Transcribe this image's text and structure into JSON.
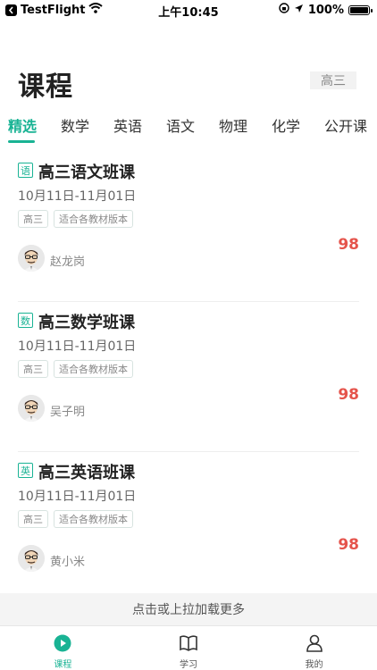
{
  "status_bar": {
    "app": "TestFlight",
    "time": "上午10:45",
    "battery": "100%"
  },
  "header": {
    "title": "课程",
    "grade": "高三"
  },
  "tabs": [
    {
      "label": "精选",
      "active": true
    },
    {
      "label": "数学",
      "active": false
    },
    {
      "label": "英语",
      "active": false
    },
    {
      "label": "语文",
      "active": false
    },
    {
      "label": "物理",
      "active": false
    },
    {
      "label": "化学",
      "active": false
    },
    {
      "label": "公开课",
      "active": false
    }
  ],
  "courses": [
    {
      "badge": "语",
      "title": "高三语文班课",
      "dates": "10月11日-11月01日",
      "tags": [
        "高三",
        "适合各教材版本"
      ],
      "teacher": "赵龙岗",
      "price": "98"
    },
    {
      "badge": "数",
      "title": "高三数学班课",
      "dates": "10月11日-11月01日",
      "tags": [
        "高三",
        "适合各教材版本"
      ],
      "teacher": "吴子明",
      "price": "98"
    },
    {
      "badge": "英",
      "title": "高三英语班课",
      "dates": "10月11日-11月01日",
      "tags": [
        "高三",
        "适合各教材版本"
      ],
      "teacher": "黄小米",
      "price": "98"
    }
  ],
  "load_more": "点击或上拉加载更多",
  "bottom_nav": [
    {
      "label": "课程",
      "icon": "play-circle-icon",
      "active": true
    },
    {
      "label": "学习",
      "icon": "book-icon",
      "active": false
    },
    {
      "label": "我的",
      "icon": "person-icon",
      "active": false
    }
  ],
  "colors": {
    "accent": "#19b394",
    "price": "#e5534b"
  }
}
